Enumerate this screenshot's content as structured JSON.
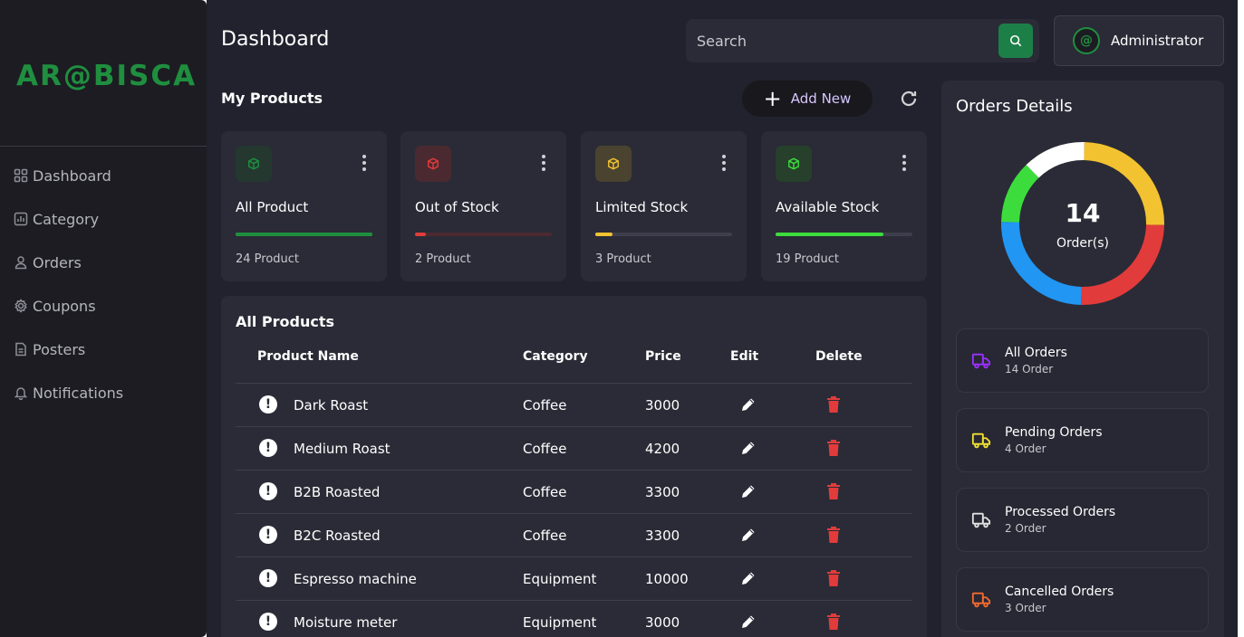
{
  "brand": {
    "logo_text": "AR@BISCA",
    "accent": "#1f8f3f"
  },
  "sidebar": {
    "items": [
      {
        "label": "Dashboard",
        "icon": "grid-icon"
      },
      {
        "label": "Category",
        "icon": "bar-chart-icon"
      },
      {
        "label": "Orders",
        "icon": "user-icon"
      },
      {
        "label": "Coupons",
        "icon": "gear-icon"
      },
      {
        "label": "Posters",
        "icon": "document-icon"
      },
      {
        "label": "Notifications",
        "icon": "bell-icon"
      }
    ]
  },
  "header": {
    "title": "Dashboard",
    "search_placeholder": "Search",
    "user_name": "Administrator",
    "avatar_text": "@"
  },
  "products": {
    "section_title": "My Products",
    "add_new_label": "Add New",
    "cards": [
      {
        "name": "All Product",
        "count": "24 Product",
        "color": "#1f8f3f",
        "track": "#1f8f3f",
        "fill_fraction": 1.0,
        "badge_bg": "#24382f"
      },
      {
        "name": "Out of Stock",
        "count": "2 Product",
        "color": "#e23b3b",
        "track": "#4a2a30",
        "fill_fraction": 0.08,
        "badge_bg": "#4a2a30"
      },
      {
        "name": "Limited Stock",
        "count": "3 Product",
        "color": "#f2c230",
        "track": "#3e3f4c",
        "fill_fraction": 0.125,
        "badge_bg": "#4a4330"
      },
      {
        "name": "Available Stock",
        "count": "19 Product",
        "color": "#3ddc3d",
        "track": "#3e3f4c",
        "fill_fraction": 0.79,
        "badge_bg": "#26402b"
      }
    ]
  },
  "table": {
    "title": "All Products",
    "headers": {
      "name": "Product Name",
      "category": "Category",
      "price": "Price",
      "edit": "Edit",
      "delete": "Delete"
    },
    "rows": [
      {
        "name": "Dark Roast",
        "category": "Coffee",
        "price": "3000"
      },
      {
        "name": "Medium Roast",
        "category": "Coffee",
        "price": "4200"
      },
      {
        "name": "B2B Roasted",
        "category": "Coffee",
        "price": "3300"
      },
      {
        "name": "B2C Roasted",
        "category": "Coffee",
        "price": "3300"
      },
      {
        "name": "Espresso machine",
        "category": "Equipment",
        "price": "10000"
      },
      {
        "name": "Moisture meter",
        "category": "Equipment",
        "price": "3000"
      }
    ]
  },
  "orders": {
    "title": "Orders Details",
    "total": "14",
    "total_label": "Order(s)",
    "donut_segments": [
      {
        "color": "#f2c230",
        "fraction": 0.25
      },
      {
        "color": "#e23b3b",
        "fraction": 0.25
      },
      {
        "color": "#2196f3",
        "fraction": 0.25
      },
      {
        "color": "#3ddc3d",
        "fraction": 0.125
      },
      {
        "color": "#ffffff",
        "fraction": 0.125
      }
    ],
    "cards": [
      {
        "title": "All Orders",
        "sub": "14 Order",
        "icon": "truck-icon",
        "color": "#9b30ff"
      },
      {
        "title": "Pending Orders",
        "sub": "4 Order",
        "icon": "truck-icon",
        "color": "#f2e030"
      },
      {
        "title": "Processed Orders",
        "sub": "2 Order",
        "icon": "truck-icon",
        "color": "#e0e0e0"
      },
      {
        "title": "Cancelled Orders",
        "sub": "3 Order",
        "icon": "truck-icon",
        "color": "#f26a30"
      }
    ]
  }
}
